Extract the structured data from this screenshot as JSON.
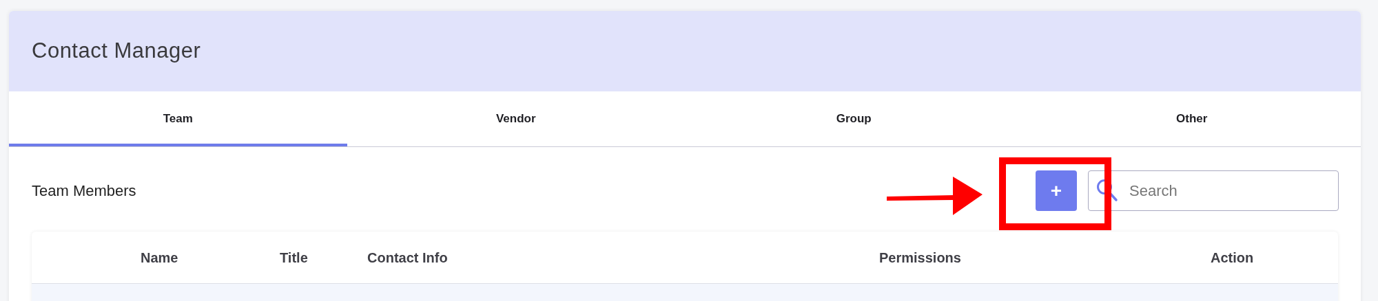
{
  "header": {
    "title": "Contact Manager"
  },
  "tabs": [
    {
      "label": "Team",
      "selected": true
    },
    {
      "label": "Vendor",
      "selected": false
    },
    {
      "label": "Group",
      "selected": false
    },
    {
      "label": "Other",
      "selected": false
    }
  ],
  "section": {
    "title": "Team Members",
    "add_button": "+",
    "search": {
      "placeholder": "Search"
    }
  },
  "table": {
    "columns": [
      "Name",
      "Title",
      "Contact Info",
      "Permissions",
      "Action"
    ]
  }
}
